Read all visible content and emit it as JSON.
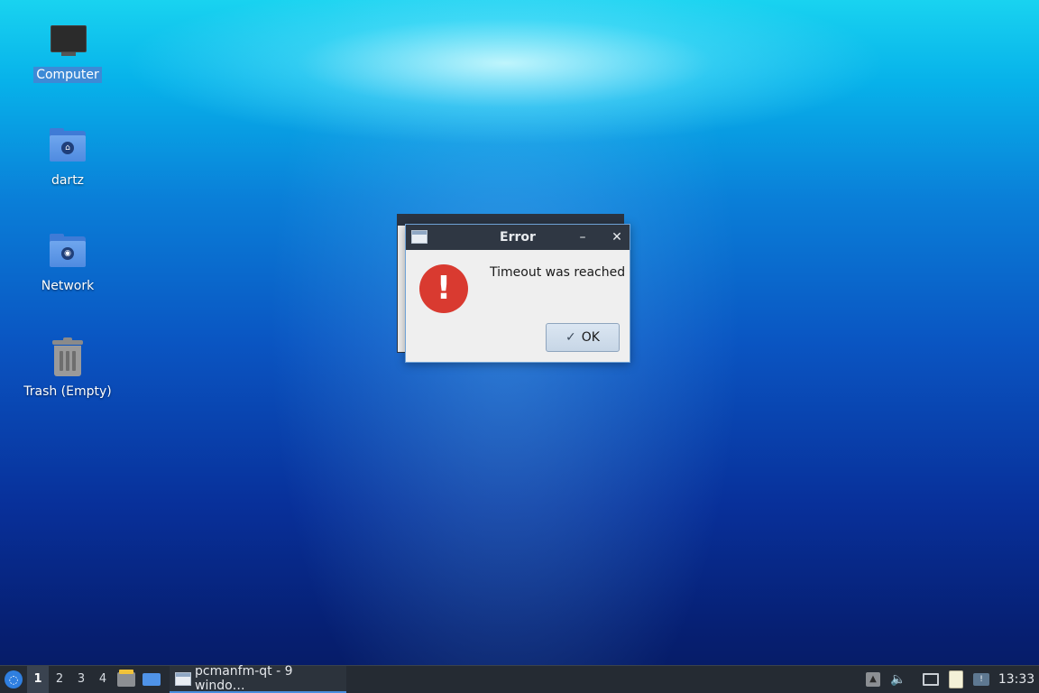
{
  "desktop": {
    "icons": [
      {
        "label": "Computer"
      },
      {
        "label": "dartz"
      },
      {
        "label": "Network"
      },
      {
        "label": "Trash (Empty)"
      }
    ]
  },
  "dialog": {
    "title": "Error",
    "minimize_glyph": "–",
    "close_glyph": "✕",
    "message": "Timeout was reached",
    "icon_glyph": "!",
    "ok_label": "OK",
    "ok_glyph": "✓"
  },
  "taskbar": {
    "workspaces": [
      "1",
      "2",
      "3",
      "4"
    ],
    "active_workspace": "1",
    "task_label": "pcmanfm-qt - 9 windo…",
    "clock": "13:33",
    "volume_glyph": "🔈",
    "tray_up_glyph": "▲"
  },
  "colors": {
    "error_red": "#d93a30",
    "titlebar": "#2f3743",
    "taskbar": "#252b33",
    "accent": "#4a8fe0"
  }
}
